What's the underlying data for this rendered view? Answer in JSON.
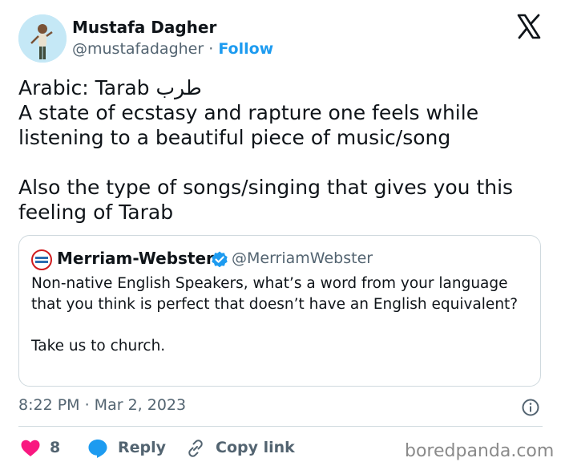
{
  "author": {
    "name": "Mustafa Dagher",
    "handle": "@mustafadagher",
    "separator": "·",
    "follow_label": "Follow"
  },
  "tweet": {
    "text": "Arabic: Tarab طرب\nA state of ecstasy and rapture one feels while listening to a beautiful piece of music/song\n\nAlso the type of songs/singing that gives you this feeling of Tarab"
  },
  "quoted": {
    "name": "Merriam-Webster",
    "handle": "@MerriamWebster",
    "text": "Non-native English Speakers, what’s a word from your language that you think is perfect that doesn’t have an English equivalent?\n\nTake us to church.",
    "logo_text": "Merriam-Webster"
  },
  "meta": {
    "timestamp": "8:22 PM · Mar 2, 2023"
  },
  "actions": {
    "like_count": "8",
    "reply_label": "Reply",
    "copy_link_label": "Copy link"
  },
  "watermark": "boredpanda.com",
  "colors": {
    "text": "#0f1419",
    "secondary": "#536471",
    "accent": "#1d9bf0",
    "like": "#f91880",
    "border": "#cfd9de"
  }
}
